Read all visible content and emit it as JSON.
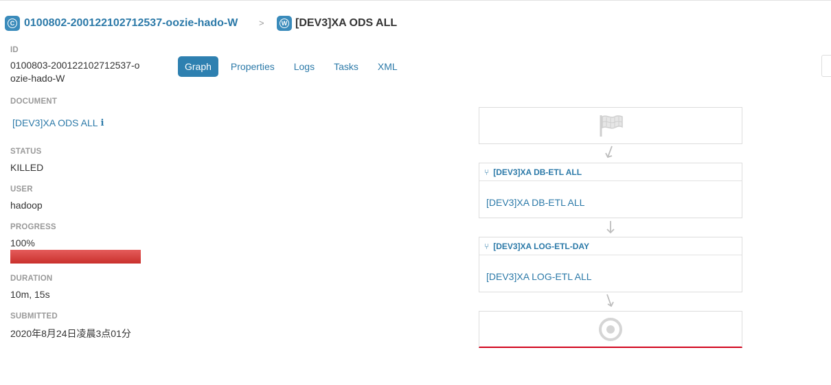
{
  "breadcrumb": {
    "coordinator_badge": "C",
    "coordinator_label": "0100802-200122102712537-oozie-hado-W",
    "separator": ">",
    "workflow_badge": "W",
    "workflow_label": "[DEV3]XA ODS ALL"
  },
  "sidebar": {
    "id_label": "ID",
    "id_value": "0100803-200122102712537-oozie-hado-W",
    "document_label": "DOCUMENT",
    "document_value": "[DEV3]XA ODS ALL",
    "document_icon": "info-icon",
    "status_label": "STATUS",
    "status_value": "KILLED",
    "user_label": "USER",
    "user_value": "hadoop",
    "progress_label": "PROGRESS",
    "progress_value": "100%",
    "progress_fraction": 1.0,
    "progress_color": "#d9534f",
    "duration_label": "DURATION",
    "duration_value": "10m, 15s",
    "submitted_label": "SUBMITTED",
    "submitted_value": "2020年8月24日凌晨3点01分"
  },
  "tabs": [
    {
      "label": "Graph",
      "active": true
    },
    {
      "label": "Properties",
      "active": false
    },
    {
      "label": "Logs",
      "active": false
    },
    {
      "label": "Tasks",
      "active": false
    },
    {
      "label": "XML",
      "active": false
    }
  ],
  "graph": {
    "start_icon": "flag-icon",
    "actions": [
      {
        "title": "[DEV3]XA DB-ETL ALL",
        "body": "[DEV3]XA DB-ETL ALL",
        "icon": "fork-icon"
      },
      {
        "title": "[DEV3]XA LOG-ETL-DAY",
        "body": "[DEV3]XA LOG-ETL ALL",
        "icon": "fork-icon"
      }
    ],
    "end_icon": "target-icon",
    "end_status_color": "#d0021b"
  },
  "colors": {
    "accent": "#2b79a8",
    "active_tab": "#2e80b0",
    "label_gray": "#999999"
  }
}
